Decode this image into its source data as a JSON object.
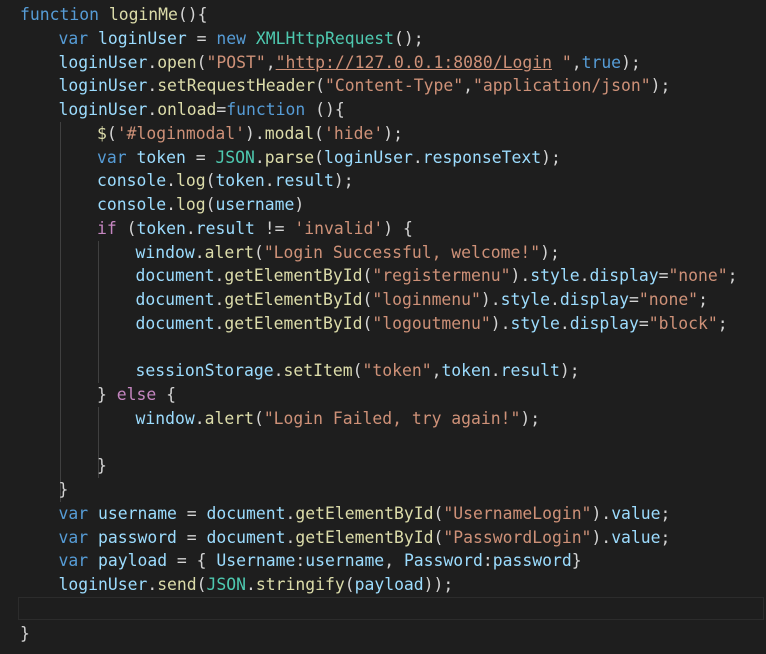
{
  "colors": {
    "background": "#1e1e1e",
    "keyword": "#569cd6",
    "control": "#c586c0",
    "function": "#dcdcaa",
    "variable": "#9cdcfe",
    "string": "#ce9178",
    "type": "#4ec9b0",
    "punctuation": "#d4d4d4"
  },
  "code_lines": [
    [
      [
        "k",
        "function"
      ],
      [
        "p",
        " "
      ],
      [
        "f",
        "loginMe"
      ],
      [
        "p",
        "(){"
      ]
    ],
    [
      [
        "k",
        "var"
      ],
      [
        "p",
        " "
      ],
      [
        "v",
        "loginUser"
      ],
      [
        "p",
        " = "
      ],
      [
        "k",
        "new"
      ],
      [
        "p",
        " "
      ],
      [
        "t",
        "XMLHttpRequest"
      ],
      [
        "p",
        "();"
      ]
    ],
    [
      [
        "v",
        "loginUser"
      ],
      [
        "p",
        "."
      ],
      [
        "f",
        "open"
      ],
      [
        "p",
        "("
      ],
      [
        "s",
        "\"POST\""
      ],
      [
        "p",
        ","
      ],
      [
        "u",
        "\"http://127.0.0.1:8080/Login"
      ],
      [
        "s",
        " \""
      ],
      [
        "p",
        ","
      ],
      [
        "k",
        "true"
      ],
      [
        "p",
        ");"
      ]
    ],
    [
      [
        "v",
        "loginUser"
      ],
      [
        "p",
        "."
      ],
      [
        "f",
        "setRequestHeader"
      ],
      [
        "p",
        "("
      ],
      [
        "s",
        "\"Content-Type\""
      ],
      [
        "p",
        ","
      ],
      [
        "s",
        "\"application/json\""
      ],
      [
        "p",
        ");"
      ]
    ],
    [
      [
        "v",
        "loginUser"
      ],
      [
        "p",
        "."
      ],
      [
        "f",
        "onload"
      ],
      [
        "p",
        "="
      ],
      [
        "k",
        "function"
      ],
      [
        "p",
        " (){"
      ]
    ],
    [
      [
        "f",
        "$"
      ],
      [
        "p",
        "("
      ],
      [
        "s",
        "'#loginmodal'"
      ],
      [
        "p",
        ")."
      ],
      [
        "f",
        "modal"
      ],
      [
        "p",
        "("
      ],
      [
        "s",
        "'hide'"
      ],
      [
        "p",
        ");"
      ]
    ],
    [
      [
        "k",
        "var"
      ],
      [
        "p",
        " "
      ],
      [
        "v",
        "token"
      ],
      [
        "p",
        " = "
      ],
      [
        "t",
        "JSON"
      ],
      [
        "p",
        "."
      ],
      [
        "f",
        "parse"
      ],
      [
        "p",
        "("
      ],
      [
        "v",
        "loginUser"
      ],
      [
        "p",
        "."
      ],
      [
        "v",
        "responseText"
      ],
      [
        "p",
        ");"
      ]
    ],
    [
      [
        "v",
        "console"
      ],
      [
        "p",
        "."
      ],
      [
        "f",
        "log"
      ],
      [
        "p",
        "("
      ],
      [
        "v",
        "token"
      ],
      [
        "p",
        "."
      ],
      [
        "v",
        "result"
      ],
      [
        "p",
        ");"
      ]
    ],
    [
      [
        "v",
        "console"
      ],
      [
        "p",
        "."
      ],
      [
        "f",
        "log"
      ],
      [
        "p",
        "("
      ],
      [
        "v",
        "username"
      ],
      [
        "p",
        ")"
      ]
    ],
    [
      [
        "c",
        "if"
      ],
      [
        "p",
        " ("
      ],
      [
        "v",
        "token"
      ],
      [
        "p",
        "."
      ],
      [
        "v",
        "result"
      ],
      [
        "p",
        " != "
      ],
      [
        "s",
        "'invalid'"
      ],
      [
        "p",
        ") {"
      ]
    ],
    [
      [
        "v",
        "window"
      ],
      [
        "p",
        "."
      ],
      [
        "f",
        "alert"
      ],
      [
        "p",
        "("
      ],
      [
        "s",
        "\"Login Successful, welcome!\""
      ],
      [
        "p",
        ");"
      ]
    ],
    [
      [
        "v",
        "document"
      ],
      [
        "p",
        "."
      ],
      [
        "f",
        "getElementById"
      ],
      [
        "p",
        "("
      ],
      [
        "s",
        "\"registermenu\""
      ],
      [
        "p",
        ")."
      ],
      [
        "v",
        "style"
      ],
      [
        "p",
        "."
      ],
      [
        "v",
        "display"
      ],
      [
        "p",
        "="
      ],
      [
        "s",
        "\"none\""
      ],
      [
        "p",
        ";"
      ]
    ],
    [
      [
        "v",
        "document"
      ],
      [
        "p",
        "."
      ],
      [
        "f",
        "getElementById"
      ],
      [
        "p",
        "("
      ],
      [
        "s",
        "\"loginmenu\""
      ],
      [
        "p",
        ")."
      ],
      [
        "v",
        "style"
      ],
      [
        "p",
        "."
      ],
      [
        "v",
        "display"
      ],
      [
        "p",
        "="
      ],
      [
        "s",
        "\"none\""
      ],
      [
        "p",
        ";"
      ]
    ],
    [
      [
        "v",
        "document"
      ],
      [
        "p",
        "."
      ],
      [
        "f",
        "getElementById"
      ],
      [
        "p",
        "("
      ],
      [
        "s",
        "\"logoutmenu\""
      ],
      [
        "p",
        ")."
      ],
      [
        "v",
        "style"
      ],
      [
        "p",
        "."
      ],
      [
        "v",
        "display"
      ],
      [
        "p",
        "="
      ],
      [
        "s",
        "\"block\""
      ],
      [
        "p",
        ";"
      ]
    ],
    [],
    [
      [
        "v",
        "sessionStorage"
      ],
      [
        "p",
        "."
      ],
      [
        "f",
        "setItem"
      ],
      [
        "p",
        "("
      ],
      [
        "s",
        "\"token\""
      ],
      [
        "p",
        ","
      ],
      [
        "v",
        "token"
      ],
      [
        "p",
        "."
      ],
      [
        "v",
        "result"
      ],
      [
        "p",
        ");"
      ]
    ],
    [
      [
        "p",
        "} "
      ],
      [
        "c",
        "else"
      ],
      [
        "p",
        " {"
      ]
    ],
    [
      [
        "v",
        "window"
      ],
      [
        "p",
        "."
      ],
      [
        "f",
        "alert"
      ],
      [
        "p",
        "("
      ],
      [
        "s",
        "\"Login Failed, try again!\""
      ],
      [
        "p",
        ");"
      ]
    ],
    [],
    [
      [
        "p",
        "}"
      ]
    ],
    [
      [
        "p",
        "}"
      ]
    ],
    [
      [
        "k",
        "var"
      ],
      [
        "p",
        " "
      ],
      [
        "v",
        "username"
      ],
      [
        "p",
        " = "
      ],
      [
        "v",
        "document"
      ],
      [
        "p",
        "."
      ],
      [
        "f",
        "getElementById"
      ],
      [
        "p",
        "("
      ],
      [
        "s",
        "\"UsernameLogin\""
      ],
      [
        "p",
        ")."
      ],
      [
        "v",
        "value"
      ],
      [
        "p",
        ";"
      ]
    ],
    [
      [
        "k",
        "var"
      ],
      [
        "p",
        " "
      ],
      [
        "v",
        "password"
      ],
      [
        "p",
        " = "
      ],
      [
        "v",
        "document"
      ],
      [
        "p",
        "."
      ],
      [
        "f",
        "getElementById"
      ],
      [
        "p",
        "("
      ],
      [
        "s",
        "\"PasswordLogin\""
      ],
      [
        "p",
        ")."
      ],
      [
        "v",
        "value"
      ],
      [
        "p",
        ";"
      ]
    ],
    [
      [
        "k",
        "var"
      ],
      [
        "p",
        " "
      ],
      [
        "v",
        "payload"
      ],
      [
        "p",
        " = { "
      ],
      [
        "v",
        "Username"
      ],
      [
        "p",
        ":"
      ],
      [
        "v",
        "username"
      ],
      [
        "p",
        ", "
      ],
      [
        "v",
        "Password"
      ],
      [
        "p",
        ":"
      ],
      [
        "v",
        "password"
      ],
      [
        "p",
        "}"
      ]
    ],
    [
      [
        "v",
        "loginUser"
      ],
      [
        "p",
        "."
      ],
      [
        "f",
        "send"
      ],
      [
        "p",
        "("
      ],
      [
        "t",
        "JSON"
      ],
      [
        "p",
        "."
      ],
      [
        "f",
        "stringify"
      ],
      [
        "p",
        "("
      ],
      [
        "v",
        "payload"
      ],
      [
        "p",
        "));"
      ]
    ],
    [],
    [
      [
        "p",
        "}"
      ]
    ]
  ]
}
